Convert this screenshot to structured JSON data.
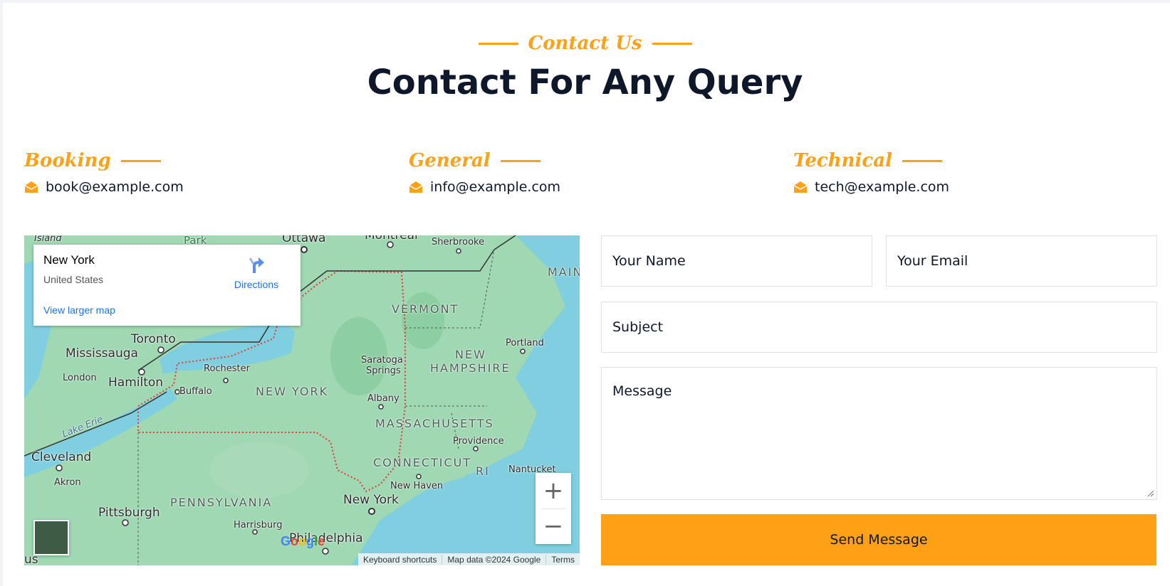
{
  "header": {
    "eyebrow": "Contact Us",
    "title": "Contact For Any Query"
  },
  "contacts": [
    {
      "label": "Booking",
      "email": "book@example.com"
    },
    {
      "label": "General",
      "email": "info@example.com"
    },
    {
      "label": "Technical",
      "email": "tech@example.com"
    }
  ],
  "map": {
    "place_title": "New York",
    "place_subtitle": "United States",
    "larger_map_link": "View larger map",
    "directions_label": "Directions",
    "zoom_in": "+",
    "zoom_out": "−",
    "attribution": {
      "shortcuts": "Keyboard shortcuts",
      "data": "Map data ©2024 Google",
      "terms": "Terms"
    },
    "labels": {
      "island": "Island",
      "park": "Park",
      "ottawa": "Ottawa",
      "montreal": "Montreal",
      "sherbrooke": "Sherbrooke",
      "maine": "MAIN",
      "toronto": "Toronto",
      "mississauga": "Mississauga",
      "hamilton": "Hamilton",
      "london": "London",
      "rochester": "Rochester",
      "buffalo": "Buffalo",
      "new_york_state": "NEW YORK",
      "vermont": "VERMONT",
      "saratoga": "Saratoga",
      "springs": "Springs",
      "albany": "Albany",
      "new_hampshire_1": "NEW",
      "new_hampshire_2": "HAMPSHIRE",
      "portland": "Portland",
      "lake_erie": "Lake Erie",
      "massachusetts": "MASSACHUSETTS",
      "providence": "Providence",
      "connecticut": "CONNECTICUT",
      "ri": "RI",
      "nantucket": "Nantucket",
      "cleveland": "Cleveland",
      "akron": "Akron",
      "new_haven": "New Haven",
      "new_york_city": "New York",
      "pennsylvania": "PENNSYLVANIA",
      "pittsburgh": "Pittsburgh",
      "harrisburg": "Harrisburg",
      "philadelphia": "Philadelphia",
      "us_edge": "us"
    }
  },
  "form": {
    "name_placeholder": "Your Name",
    "email_placeholder": "Your Email",
    "subject_placeholder": "Subject",
    "message_placeholder": "Message",
    "submit_label": "Send Message"
  },
  "colors": {
    "accent": "#fea116",
    "heading": "#0f172b",
    "map_land": "#9fd8b3",
    "map_water": "#7fcfe0"
  }
}
